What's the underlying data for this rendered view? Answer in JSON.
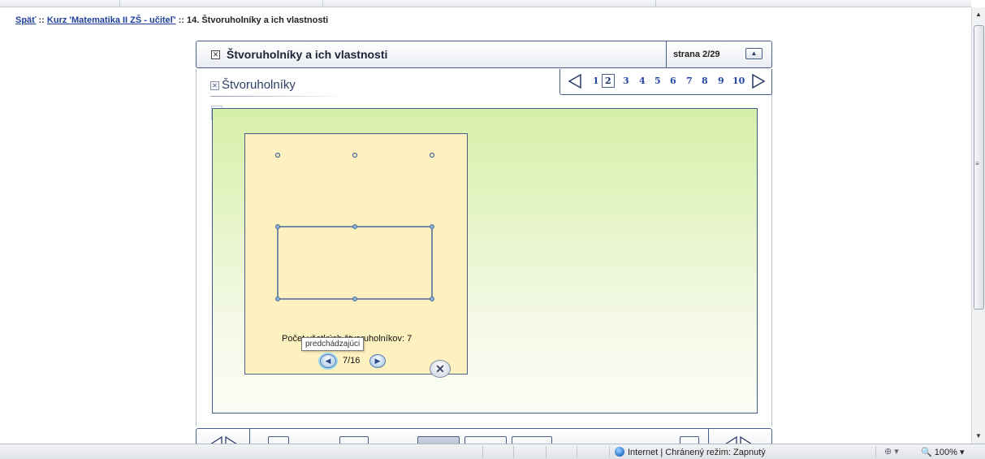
{
  "breadcrumb": {
    "back": "Späť",
    "sep1": " :: ",
    "course": "Kurz 'Matematika II ZŠ - učiteľ'",
    "sep2": " :: ",
    "current": "14. Štvoruholníky a ich vlastnosti"
  },
  "header": {
    "title": "Štvoruholníky a ich vlastnosti",
    "page_label": "strana  2/29",
    "collapse_symbol": "▲",
    "close_symbol": "✕"
  },
  "section": {
    "title": "Štvoruholníky",
    "icon_symbol": "✕"
  },
  "pager": {
    "pages": [
      "1",
      "2",
      "3",
      "4",
      "5",
      "6",
      "7",
      "8",
      "9",
      "10"
    ],
    "current_page": "2"
  },
  "stage": {
    "info_label": "i",
    "count_text": "Počet všetkých štvoruholníkov: 7",
    "tooltip": "predchádzajúci",
    "slide_counter": "7/16",
    "prev_symbol": "◀",
    "next_symbol": "▶",
    "close_symbol": "✕"
  },
  "status_bar": {
    "zone": "Internet | Chránený režim: Zapnutý",
    "zoom": "100%",
    "protected_icon": "⊕ ▾"
  },
  "colors": {
    "frame_border": "#4a5c8a",
    "stage_green": "#d6efa8",
    "panel_yellow": "#fdf1bf",
    "link_blue": "#1f3f9a"
  }
}
